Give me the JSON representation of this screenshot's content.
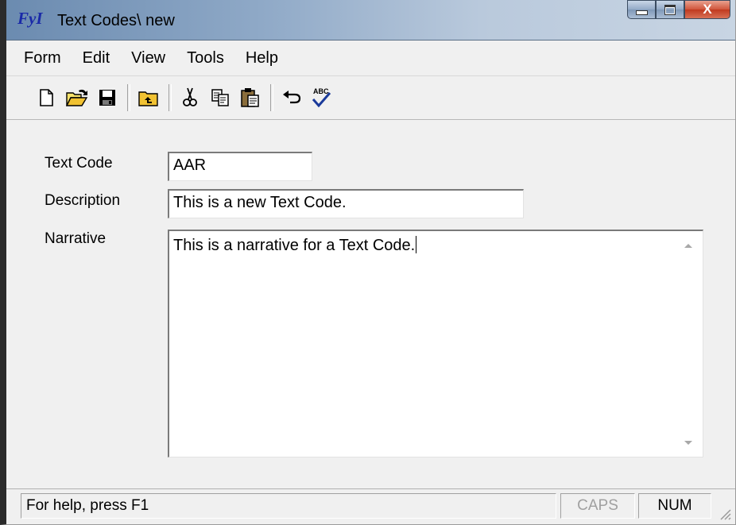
{
  "window": {
    "logo": "FyI",
    "title": "Text Codes\\ new",
    "close_glyph": "X"
  },
  "menu": [
    "Form",
    "Edit",
    "View",
    "Tools",
    "Help"
  ],
  "toolbar": {
    "icons": [
      "new-document-icon",
      "open-folder-icon",
      "save-icon",
      "up-folder-icon",
      "cut-icon",
      "copy-icon",
      "paste-icon",
      "undo-icon",
      "spell-check-icon"
    ]
  },
  "form": {
    "text_code_label": "Text Code",
    "text_code_value": "AAR",
    "description_label": "Description",
    "description_value": "This is a new Text Code.",
    "narrative_label": "Narrative",
    "narrative_value": "This is a narrative for a Text Code."
  },
  "status": {
    "help_text": "For help, press F1",
    "caps": "CAPS",
    "num": "NUM"
  }
}
